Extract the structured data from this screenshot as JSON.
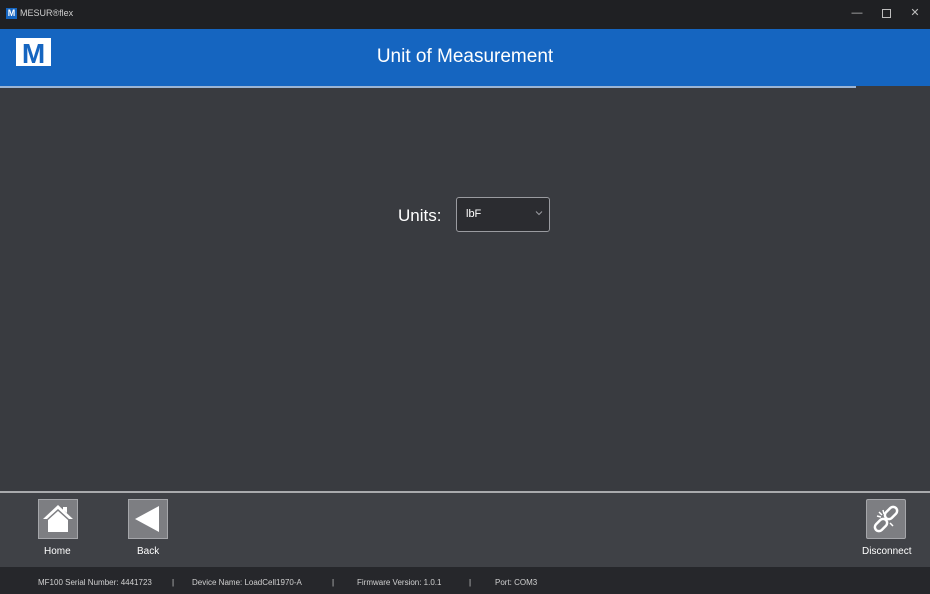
{
  "window": {
    "logo_letter": "M",
    "app_title": "MESUR®flex",
    "minimize_glyph": "—",
    "close_glyph": "✕"
  },
  "header": {
    "logo_letter": "M",
    "title": "Unit of Measurement"
  },
  "units": {
    "label": "Units:",
    "selected": "lbF"
  },
  "nav": {
    "home_label": "Home",
    "back_label": "Back",
    "disconnect_label": "Disconnect"
  },
  "status": {
    "serial": "MF100 Serial Number: 4441723",
    "device": "Device Name: LoadCell1970-A",
    "firmware": "Firmware Version: 1.0.1",
    "port": "Port: COM3",
    "separator": "|"
  },
  "colors": {
    "brand_blue": "#1565c0",
    "background": "#393b40",
    "button_gray": "#7d7e82"
  }
}
